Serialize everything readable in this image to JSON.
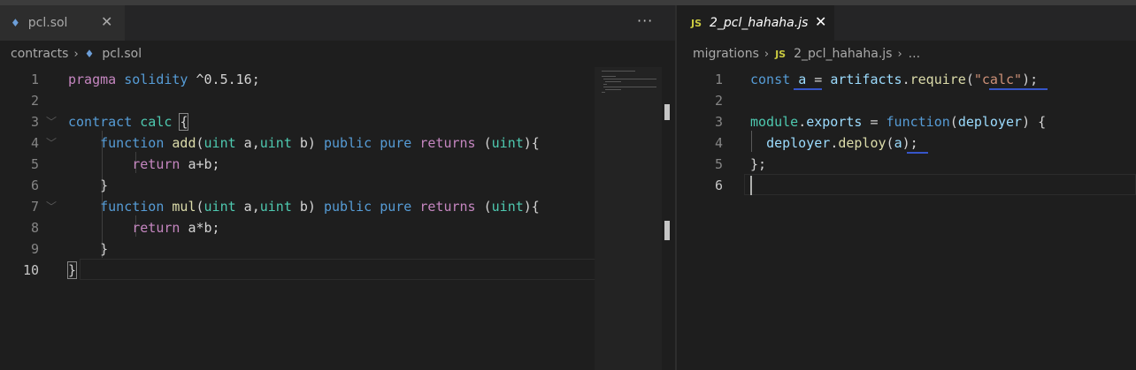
{
  "left_editor": {
    "tab": {
      "icon": "solidity-icon",
      "label": "pcl.sol",
      "close": "✕"
    },
    "more_actions": "···",
    "breadcrumb": {
      "folder": "contracts",
      "separator": "›",
      "file": "pcl.sol"
    },
    "line_numbers": [
      "1",
      "2",
      "3",
      "4",
      "5",
      "6",
      "7",
      "8",
      "9",
      "10"
    ]
  },
  "right_editor": {
    "tab": {
      "icon": "javascript-icon",
      "icon_text": "JS",
      "label": "2_pcl_hahaha.js",
      "close": "✕"
    },
    "breadcrumb": {
      "folder": "migrations",
      "separator": "›",
      "icon_text": "JS",
      "file": "2_pcl_hahaha.js",
      "more": "..."
    },
    "line_numbers": [
      "1",
      "2",
      "3",
      "4",
      "5",
      "6"
    ]
  },
  "colors": {
    "keyword": "#c586c0",
    "storage_keyword": "#569cd6",
    "type": "#4ec9b0",
    "function": "#dcdcaa",
    "variable": "#9cdcfe",
    "string": "#ce9178",
    "number": "#b5cea8",
    "background": "#1e1e1e",
    "squiggle": "#3655c9"
  }
}
